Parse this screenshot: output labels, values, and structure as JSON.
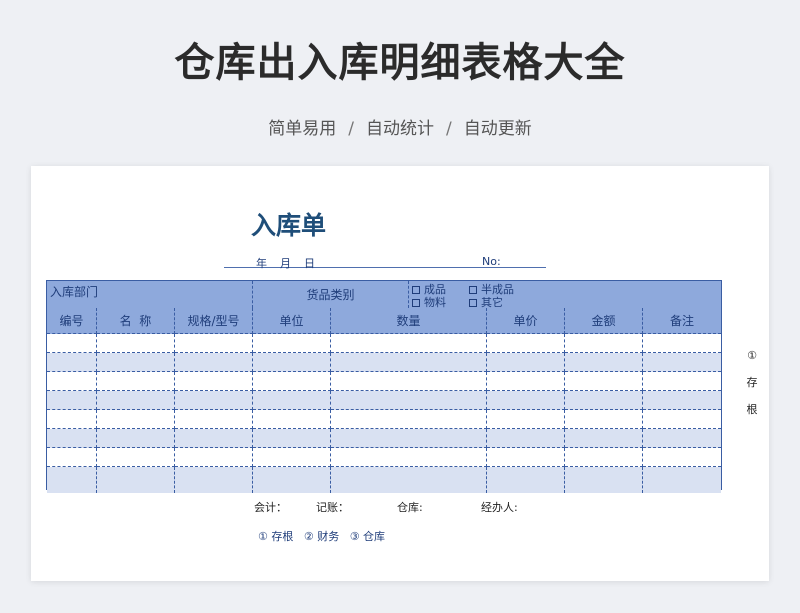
{
  "header": {
    "title": "仓库出入库明细表格大全",
    "subtitle_items": [
      "简单易用",
      "自动统计",
      "自动更新"
    ],
    "separator": "/"
  },
  "form": {
    "title": "入库单",
    "date_labels": [
      "年",
      "月",
      "日"
    ],
    "no_label": "No:",
    "dept_label": "入库部门",
    "category_label": "货品类别",
    "category_options": [
      "成品",
      "半成品",
      "物料",
      "其它"
    ],
    "columns": [
      "编号",
      "名  称",
      "规格/型号",
      "单位",
      "数量",
      "单价",
      "金额",
      "备注"
    ],
    "row_count": 8,
    "footer": [
      "会计：",
      "记账：",
      "仓库:",
      "经办人:"
    ],
    "copies": "① 存根   ② 财务   ③ 仓库",
    "side_note": [
      "①",
      "存",
      "根"
    ]
  }
}
